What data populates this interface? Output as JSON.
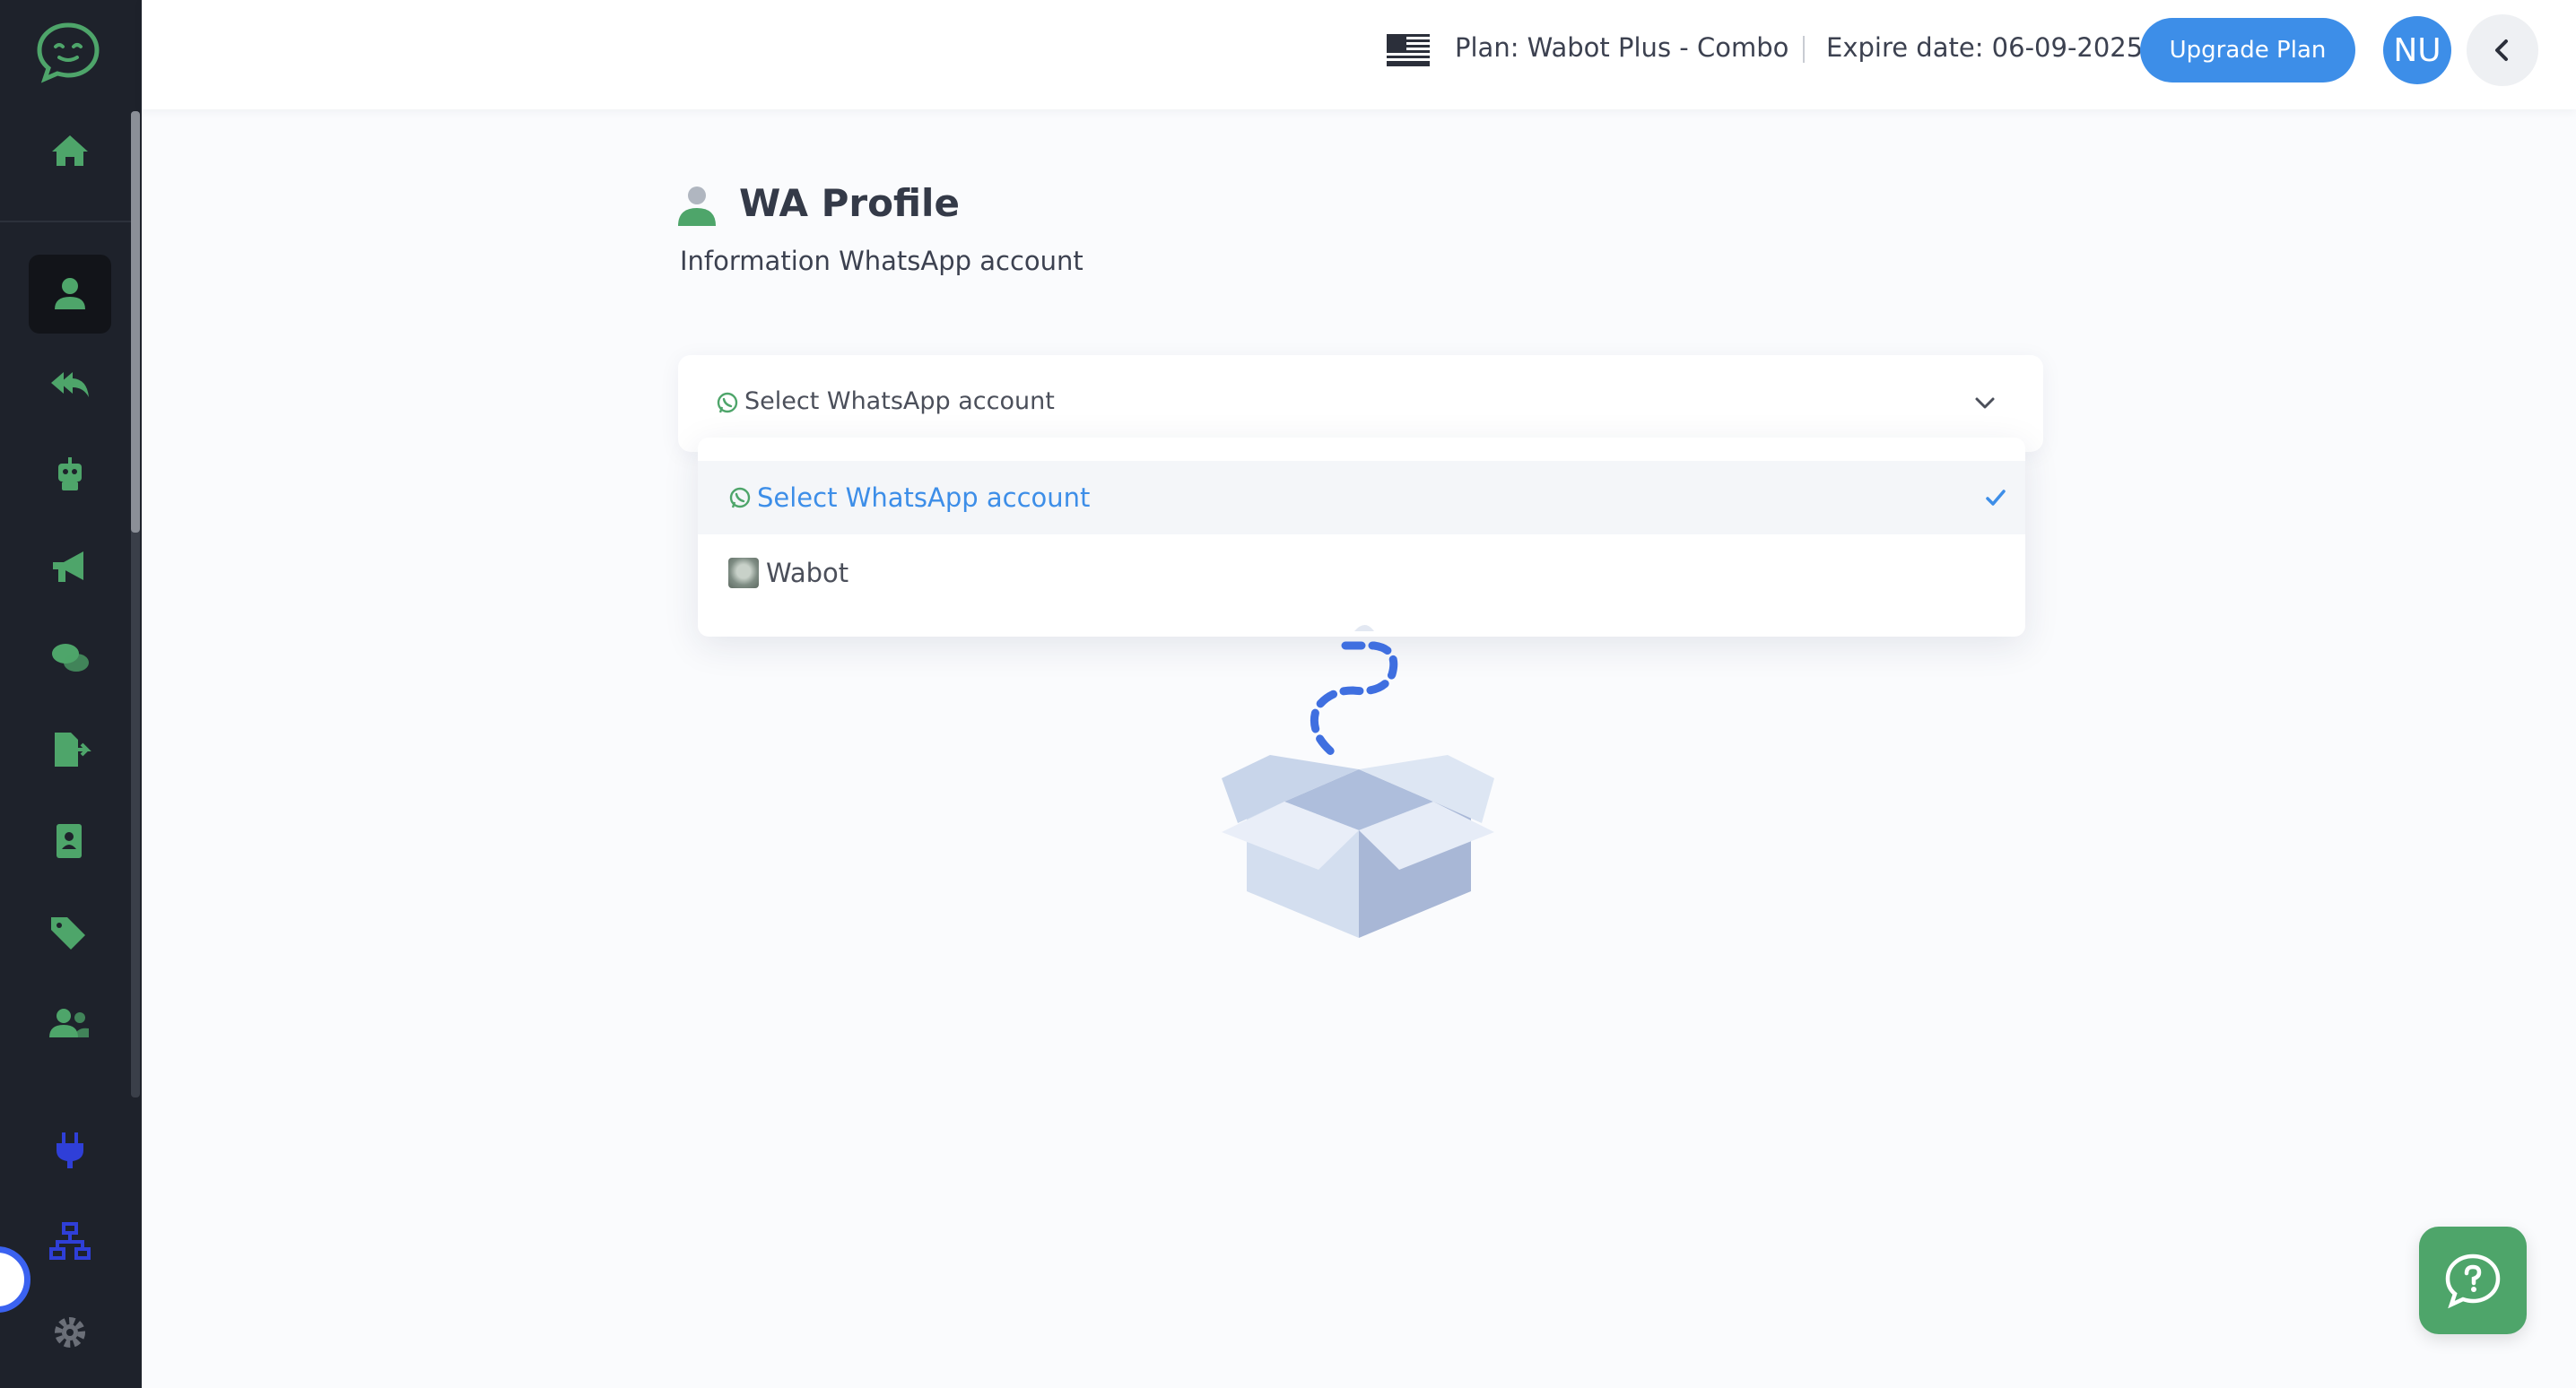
{
  "header": {
    "plan_label": "Plan: Wabot Plus - Combo",
    "expire_label": "Expire date: 06-09-2025",
    "upgrade_button": "Upgrade Plan",
    "avatar_initials": "NU",
    "flag_icon": "us-flag-icon",
    "collapse_icon": "chevron-left-icon"
  },
  "sidebar": {
    "logo_icon": "chat-bubble-logo-icon",
    "items": [
      {
        "icon": "home-icon",
        "active": false
      },
      {
        "icon": "user-icon",
        "active": true
      },
      {
        "icon": "reply-all-icon",
        "active": false
      },
      {
        "icon": "robot-icon",
        "active": false
      },
      {
        "icon": "megaphone-icon",
        "active": false
      },
      {
        "icon": "chat-icon",
        "active": false
      },
      {
        "icon": "file-export-icon",
        "active": false
      },
      {
        "icon": "contact-book-icon",
        "active": false
      },
      {
        "icon": "tags-icon",
        "active": false
      },
      {
        "icon": "users-icon",
        "active": false
      },
      {
        "icon": "plug-icon",
        "active": false
      },
      {
        "icon": "sitemap-icon",
        "active": false
      },
      {
        "icon": "gear-icon",
        "active": false
      }
    ]
  },
  "page": {
    "title": "WA Profile",
    "subtitle": "Information WhatsApp account"
  },
  "select": {
    "value": "Select WhatsApp account",
    "options": [
      {
        "label": "Select WhatsApp account",
        "selected": true
      },
      {
        "label": "Wabot",
        "selected": false
      }
    ]
  },
  "colors": {
    "accent_blue": "#3d8ee8",
    "brand_green": "#4ea56a",
    "sidebar_bg": "#1e222b"
  },
  "help_icon": "question-chat-icon"
}
